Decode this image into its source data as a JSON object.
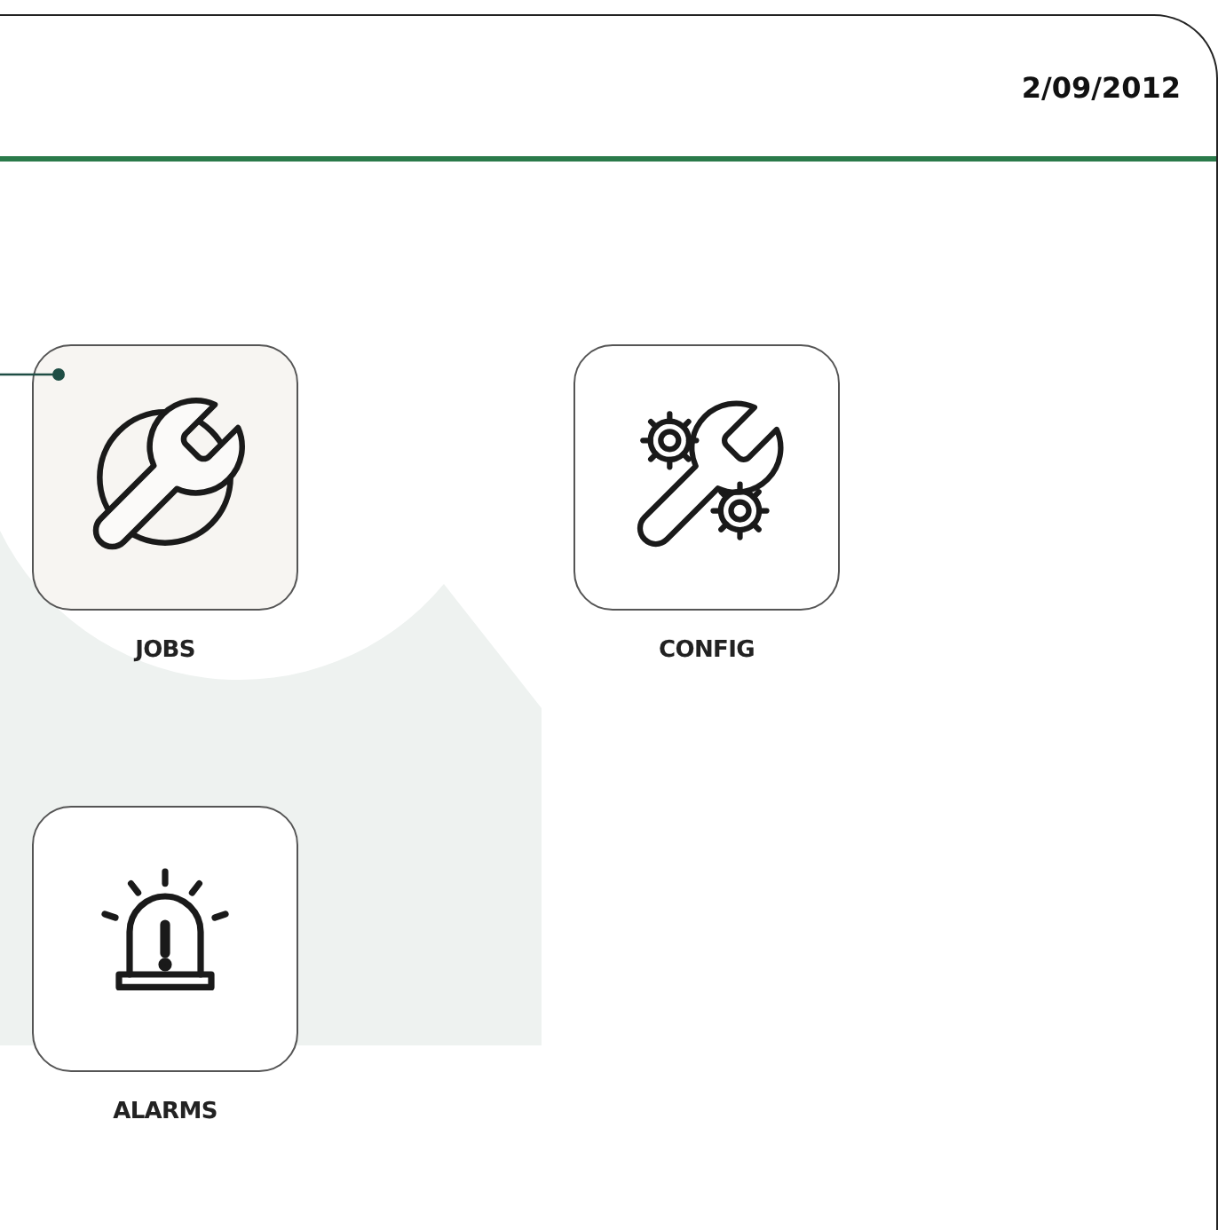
{
  "header": {
    "date": "2/09/2012"
  },
  "tiles": [
    {
      "label": "JOBS",
      "kind": "jobs",
      "selected": true
    },
    {
      "label": "CONFIG",
      "kind": "config",
      "selected": false
    },
    {
      "label": "ALARMS",
      "kind": "alarms",
      "selected": false
    }
  ]
}
